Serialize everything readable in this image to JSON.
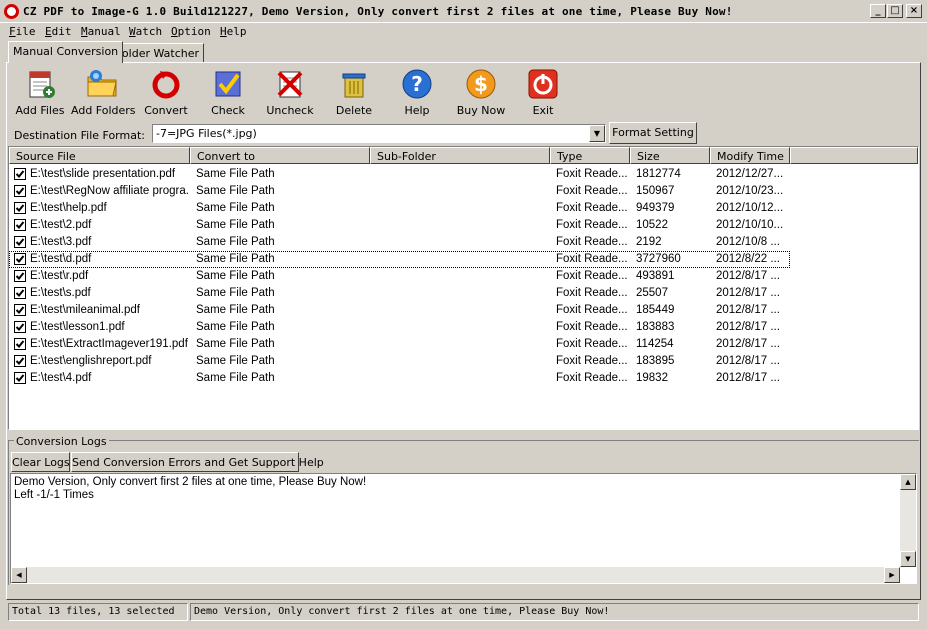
{
  "window": {
    "title": "CZ PDF to Image-G 1.0 Build121227, Demo Version, Only convert first 2 files at one time, Please Buy Now!",
    "minimize": "_",
    "maximize": "□",
    "close": "×"
  },
  "menu": [
    "File",
    "Edit",
    "Manual",
    "Watch",
    "Option",
    "Help"
  ],
  "tabs": [
    "Manual Conversion",
    "Folder Watcher"
  ],
  "toolbar": [
    {
      "label": "Add Files",
      "icon": "add-files-icon"
    },
    {
      "label": "Add Folders",
      "icon": "add-folders-icon"
    },
    {
      "label": "Convert",
      "icon": "convert-icon"
    },
    {
      "label": "Check",
      "icon": "check-icon"
    },
    {
      "label": "Uncheck",
      "icon": "uncheck-icon"
    },
    {
      "label": "Delete",
      "icon": "delete-icon"
    },
    {
      "label": "Help",
      "icon": "help-icon"
    },
    {
      "label": "Buy Now",
      "icon": "buy-now-icon"
    },
    {
      "label": "Exit",
      "icon": "exit-icon"
    }
  ],
  "destination": {
    "label": "Destination File Format:",
    "value": "-7=JPG Files(*.jpg)",
    "format_button": "Format Setting"
  },
  "columns": [
    "Source File",
    "Convert to",
    "Sub-Folder",
    "Type",
    "Size",
    "Modify Time"
  ],
  "files": [
    {
      "source": "E:\\test\\slide presentation.pdf",
      "convert_to": "Same File Path",
      "sub_folder": "",
      "type": "Foxit Reade...",
      "size": "1812774",
      "modified": "2012/12/27...",
      "checked": true
    },
    {
      "source": "E:\\test\\RegNow affiliate progra...",
      "convert_to": "Same File Path",
      "sub_folder": "",
      "type": "Foxit Reade...",
      "size": "150967",
      "modified": "2012/10/23...",
      "checked": true
    },
    {
      "source": "E:\\test\\help.pdf",
      "convert_to": "Same File Path",
      "sub_folder": "",
      "type": "Foxit Reade...",
      "size": "949379",
      "modified": "2012/10/12...",
      "checked": true
    },
    {
      "source": "E:\\test\\2.pdf",
      "convert_to": "Same File Path",
      "sub_folder": "",
      "type": "Foxit Reade...",
      "size": "10522",
      "modified": "2012/10/10...",
      "checked": true
    },
    {
      "source": "E:\\test\\3.pdf",
      "convert_to": "Same File Path",
      "sub_folder": "",
      "type": "Foxit Reade...",
      "size": "2192",
      "modified": "2012/10/8 ...",
      "checked": true
    },
    {
      "source": "E:\\test\\d.pdf",
      "convert_to": "Same File Path",
      "sub_folder": "",
      "type": "Foxit Reade...",
      "size": "3727960",
      "modified": "2012/8/22 ...",
      "checked": true
    },
    {
      "source": "E:\\test\\r.pdf",
      "convert_to": "Same File Path",
      "sub_folder": "",
      "type": "Foxit Reade...",
      "size": "493891",
      "modified": "2012/8/17 ...",
      "checked": true
    },
    {
      "source": "E:\\test\\s.pdf",
      "convert_to": "Same File Path",
      "sub_folder": "",
      "type": "Foxit Reade...",
      "size": "25507",
      "modified": "2012/8/17 ...",
      "checked": true
    },
    {
      "source": "E:\\test\\mileanimal.pdf",
      "convert_to": "Same File Path",
      "sub_folder": "",
      "type": "Foxit Reade...",
      "size": "185449",
      "modified": "2012/8/17 ...",
      "checked": true
    },
    {
      "source": "E:\\test\\lesson1.pdf",
      "convert_to": "Same File Path",
      "sub_folder": "",
      "type": "Foxit Reade...",
      "size": "183883",
      "modified": "2012/8/17 ...",
      "checked": true
    },
    {
      "source": "E:\\test\\ExtractImagever191.pdf",
      "convert_to": "Same File Path",
      "sub_folder": "",
      "type": "Foxit Reade...",
      "size": "114254",
      "modified": "2012/8/17 ...",
      "checked": true
    },
    {
      "source": "E:\\test\\englishreport.pdf",
      "convert_to": "Same File Path",
      "sub_folder": "",
      "type": "Foxit Reade...",
      "size": "183895",
      "modified": "2012/8/17 ...",
      "checked": true
    },
    {
      "source": "E:\\test\\4.pdf",
      "convert_to": "Same File Path",
      "sub_folder": "",
      "type": "Foxit Reade...",
      "size": "19832",
      "modified": "2012/8/17 ...",
      "checked": true
    }
  ],
  "logs": {
    "group_label": "Conversion Logs",
    "clear_button": "Clear Logs",
    "support_button": "Send Conversion Errors and Get Support Help",
    "lines": [
      "Demo Version, Only convert first 2 files at one time, Please Buy Now!",
      "Left -1/-1 Times"
    ]
  },
  "status": {
    "files": "Total 13 files, 13 selected",
    "message": "Demo Version, Only convert first 2 files at one time, Please Buy Now!"
  },
  "colors": {
    "face": "#d4d0c8",
    "title_icon_red": "#d40000",
    "list_background": "#ffffff"
  }
}
